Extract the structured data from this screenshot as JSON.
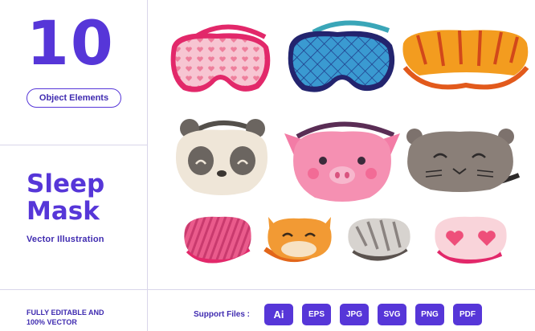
{
  "header": {
    "count": "10",
    "count_label": "Object Elements"
  },
  "product": {
    "title_line1": "Sleep",
    "title_line2": "Mask",
    "subtitle": "Vector Illustration"
  },
  "footer": {
    "editable_line1": "FULLY EDITABLE  AND",
    "editable_line2": "100% VECTOR",
    "support_label": "Support Files :",
    "formats": [
      "Ai",
      "EPS",
      "JPG",
      "SVG",
      "PNG",
      "PDF"
    ]
  },
  "colors": {
    "brand_purple": "#5636d8",
    "text_purple": "#3f2bb0",
    "divider": "#d9d6ea"
  },
  "masks": [
    {
      "name": "pink-hearts",
      "icon": "pink-heart-mask-icon"
    },
    {
      "name": "blue-quilted",
      "icon": "blue-quilted-mask-icon"
    },
    {
      "name": "tiger-stripe",
      "icon": "tiger-mask-icon"
    },
    {
      "name": "panda",
      "icon": "panda-mask-icon"
    },
    {
      "name": "pig",
      "icon": "pig-mask-icon"
    },
    {
      "name": "cat-grey",
      "icon": "grey-cat-mask-icon"
    },
    {
      "name": "pink-striped",
      "icon": "pink-striped-mask-icon"
    },
    {
      "name": "fox",
      "icon": "fox-mask-icon"
    },
    {
      "name": "zebra",
      "icon": "zebra-mask-icon"
    },
    {
      "name": "heart-eyes",
      "icon": "heart-eyes-mask-icon"
    }
  ]
}
